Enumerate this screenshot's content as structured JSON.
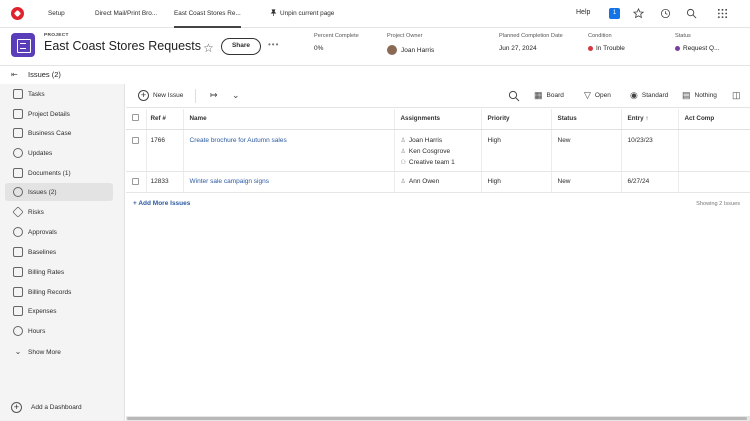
{
  "topbar": {
    "tabs": [
      {
        "label": "Setup"
      },
      {
        "label": "Direct Mail/Print Bro..."
      },
      {
        "label": "East Coast Stores Re..."
      }
    ],
    "unpin_label": "Unpin current page",
    "help_label": "Help",
    "notification_count": "1"
  },
  "project": {
    "type_label": "PROJECT",
    "title": "East Coast Stores Requests",
    "share_label": "Share",
    "more_label": "•••",
    "meta": [
      {
        "key": "Percent Complete",
        "value": "0%"
      },
      {
        "key": "Project Owner",
        "value": "Joan Harris"
      },
      {
        "key": "Planned Completion Date",
        "value": "Jun 27, 2024"
      },
      {
        "key": "Condition",
        "value": "In Trouble",
        "color": "#d7373f"
      },
      {
        "key": "Status",
        "value": "Request Q...",
        "color": "#7a3ea0"
      }
    ]
  },
  "section": {
    "title": "Issues (2)"
  },
  "sidebar": {
    "items": [
      {
        "label": "Tasks"
      },
      {
        "label": "Project Details"
      },
      {
        "label": "Business Case"
      },
      {
        "label": "Updates"
      },
      {
        "label": "Documents (1)"
      },
      {
        "label": "Issues (2)"
      },
      {
        "label": "Risks"
      },
      {
        "label": "Approvals"
      },
      {
        "label": "Baselines"
      },
      {
        "label": "Billing Rates"
      },
      {
        "label": "Billing Records"
      },
      {
        "label": "Expenses"
      },
      {
        "label": "Hours"
      },
      {
        "label": "Show More"
      }
    ],
    "add_dashboard": "Add a Dashboard"
  },
  "toolbar": {
    "new_issue": "New Issue",
    "board": "Board",
    "filter": "Open",
    "view": "Standard",
    "grouping": "Nothing"
  },
  "table": {
    "columns": [
      "Ref #",
      "Name",
      "Assignments",
      "Priority",
      "Status",
      "Entry ↑",
      "Act Comp"
    ],
    "rows": [
      {
        "ref": "1766",
        "name": "Create brochure for Autumn sales",
        "assignments": [
          "Joan Harris",
          "Ken Cosgrove",
          "Creative team 1"
        ],
        "priority": "High",
        "status": "New",
        "entry": "10/23/23",
        "act_comp": ""
      },
      {
        "ref": "12833",
        "name": "Winter sale campaign signs",
        "assignments": [
          "Ann Owen"
        ],
        "priority": "High",
        "status": "New",
        "entry": "6/27/24",
        "act_comp": ""
      }
    ],
    "add_more": "+ Add More Issues",
    "showing": "Showing 2 Issues"
  }
}
